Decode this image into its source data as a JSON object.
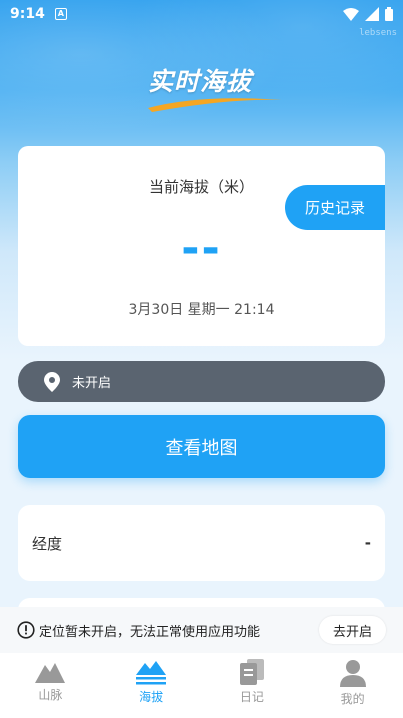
{
  "status_bar": {
    "time": "9:14",
    "notification_icon": "A",
    "icons": [
      "wifi-icon",
      "signal-icon",
      "battery-icon"
    ]
  },
  "watermark": "lebsens",
  "app_logo": "实时海拔",
  "altitude_card": {
    "label": "当前海拔（米）",
    "value": "--",
    "history_button": "历史记录",
    "datetime": "3月30日 星期一 21:14"
  },
  "location_status": {
    "icon": "location-pin-icon",
    "text": "未开启"
  },
  "view_map_button": "查看地图",
  "info_rows": [
    {
      "label": "经度",
      "value": "-"
    },
    {
      "label": "",
      "value": ""
    }
  ],
  "warning": {
    "icon": "alert-circle-icon",
    "text": "定位暂未开启，无法正常使用应用功能",
    "button": "去开启"
  },
  "tabs": [
    {
      "label": "山脉",
      "icon": "mountain-icon",
      "active": false
    },
    {
      "label": "海拔",
      "icon": "altitude-icon",
      "active": true
    },
    {
      "label": "日记",
      "icon": "diary-icon",
      "active": false
    },
    {
      "label": "我的",
      "icon": "profile-icon",
      "active": false
    }
  ],
  "colors": {
    "accent": "#1fa2f5",
    "location_bar": "#5a6470",
    "tab_inactive": "#999999",
    "logo_swoosh": "#f5a623"
  }
}
